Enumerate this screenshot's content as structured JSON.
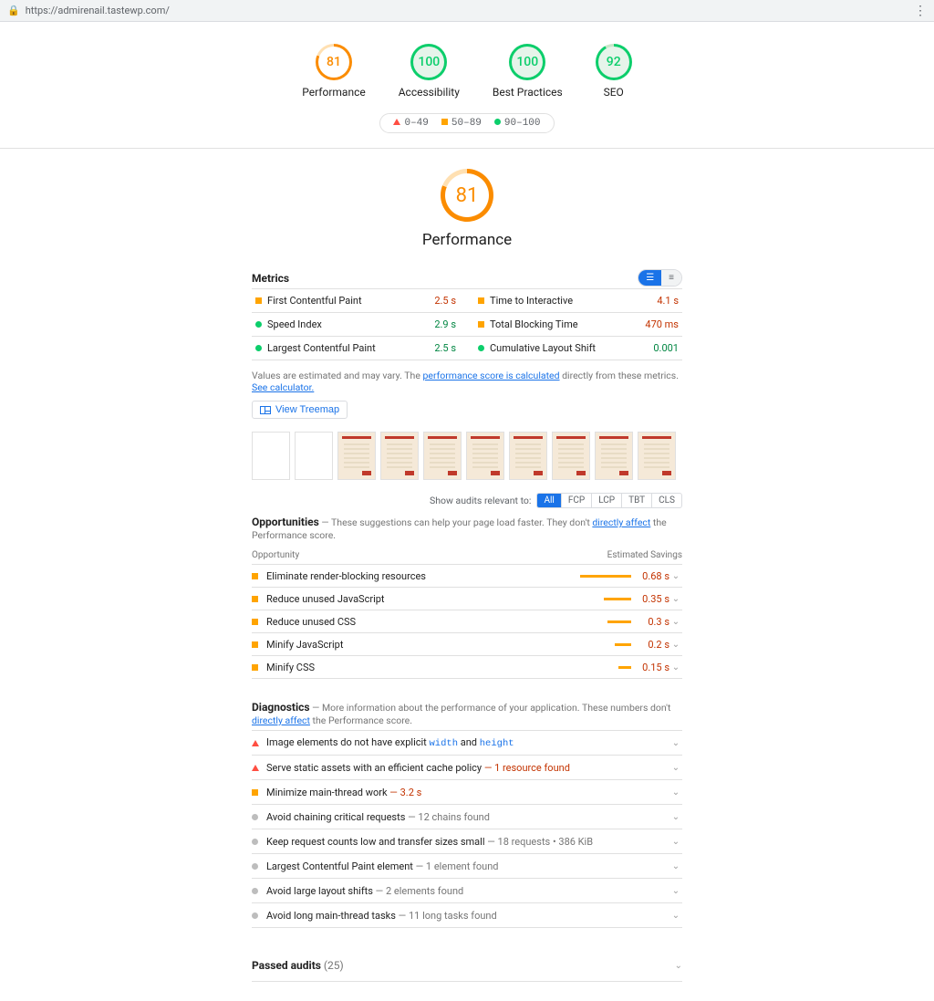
{
  "urlbar": {
    "url": "https://admirenail.tastewp.com/"
  },
  "gauges": [
    {
      "score": "81",
      "label": "Performance",
      "class": "gauge-orange"
    },
    {
      "score": "100",
      "label": "Accessibility",
      "class": "gauge-green"
    },
    {
      "score": "100",
      "label": "Best Practices",
      "class": "gauge-green"
    },
    {
      "score": "92",
      "label": "SEO",
      "class": "gauge-green gauge-green92"
    }
  ],
  "legend": {
    "poor": "0–49",
    "mid": "50–89",
    "good": "90–100"
  },
  "big": {
    "score": "81",
    "title": "Performance"
  },
  "metrics_title": "Metrics",
  "metrics": [
    {
      "icon": "sq",
      "name": "First Contentful Paint",
      "val": "2.5 s",
      "cls": "val-orange"
    },
    {
      "icon": "sq",
      "name": "Time to Interactive",
      "val": "4.1 s",
      "cls": "val-orange"
    },
    {
      "icon": "dotg",
      "name": "Speed Index",
      "val": "2.9 s",
      "cls": "val-green"
    },
    {
      "icon": "sq",
      "name": "Total Blocking Time",
      "val": "470 ms",
      "cls": "val-orange"
    },
    {
      "icon": "dotg",
      "name": "Largest Contentful Paint",
      "val": "2.5 s",
      "cls": "val-green"
    },
    {
      "icon": "dotg",
      "name": "Cumulative Layout Shift",
      "val": "0.001",
      "cls": "val-green"
    }
  ],
  "note": {
    "pre": "Values are estimated and may vary. The ",
    "link1": "performance score is calculated",
    "mid": " directly from these metrics. ",
    "link2": "See calculator."
  },
  "treemap_label": "View Treemap",
  "filter_label": "Show audits relevant to:",
  "filters": [
    "All",
    "FCP",
    "LCP",
    "TBT",
    "CLS"
  ],
  "opps_title": "Opportunities",
  "opps_desc": " — These suggestions can help your page load faster. They don't ",
  "opps_link": "directly affect",
  "opps_desc2": " the Performance score.",
  "opps_head_l": "Opportunity",
  "opps_head_r": "Estimated Savings",
  "opps": [
    {
      "name": "Eliminate render-blocking resources",
      "save": "0.68 s",
      "bar": 56
    },
    {
      "name": "Reduce unused JavaScript",
      "save": "0.35 s",
      "bar": 30
    },
    {
      "name": "Reduce unused CSS",
      "save": "0.3 s",
      "bar": 26
    },
    {
      "name": "Minify JavaScript",
      "save": "0.2 s",
      "bar": 18
    },
    {
      "name": "Minify CSS",
      "save": "0.15 s",
      "bar": 14
    }
  ],
  "diag_title": "Diagnostics",
  "diag_desc1": " — More information about the performance of your application. These numbers don't ",
  "diag_link": "directly affect",
  "diag_desc2": " the Performance score.",
  "diags": [
    {
      "icon": "tri",
      "name": "Image elements do not have explicit ",
      "code1": "width",
      "mid": " and ",
      "code2": "height",
      "extra": ""
    },
    {
      "icon": "tri",
      "name": "Serve static assets with an efficient cache policy",
      "extra": " — 1 resource found",
      "extracls": "red"
    },
    {
      "icon": "sq",
      "name": "Minimize main-thread work",
      "extra": " — 3.2 s",
      "extracls": "red"
    },
    {
      "icon": "dotgrey",
      "name": "Avoid chaining critical requests",
      "extra": " — 12 chains found"
    },
    {
      "icon": "dotgrey",
      "name": "Keep request counts low and transfer sizes small",
      "extra": " — 18 requests • 386 KiB"
    },
    {
      "icon": "dotgrey",
      "name": "Largest Contentful Paint element",
      "extra": " — 1 element found"
    },
    {
      "icon": "dotgrey",
      "name": "Avoid large layout shifts",
      "extra": " — 2 elements found"
    },
    {
      "icon": "dotgrey",
      "name": "Avoid long main-thread tasks",
      "extra": " — 11 long tasks found"
    }
  ],
  "passed": {
    "label": "Passed audits",
    "count": "(25)"
  }
}
